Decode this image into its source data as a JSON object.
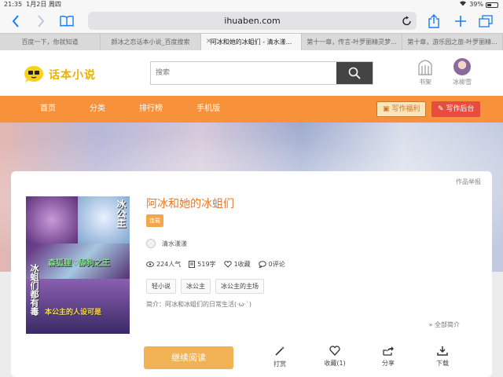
{
  "status_bar": {
    "time": "21:35",
    "date": "1月2日 周四",
    "battery_text": "39%",
    "battery_level": 0.39
  },
  "browser": {
    "url": "ihuaben.com",
    "tabs": [
      {
        "title": "百度一下，你就知道",
        "active": false
      },
      {
        "title": "颜冰之恋话本小说_百度搜索",
        "active": false
      },
      {
        "title": "阿冰和她的冰蛆们 - 清水漾...",
        "active": true
      },
      {
        "title": "第十一章，传言-叶罗丽精灵梦...",
        "active": false
      },
      {
        "title": "第十章，游乐园之旅-叶罗丽精...",
        "active": false
      }
    ]
  },
  "site": {
    "logo_text": "话本小说",
    "search_placeholder": "搜索",
    "bookshelf_label": "书架",
    "user_name": "冰柳雪"
  },
  "nav": {
    "items": [
      "首页",
      "分类",
      "排行榜",
      "手机版"
    ],
    "welfare_label": "写作福利",
    "backend_label": "写作后台"
  },
  "book": {
    "report_label": "作品举报",
    "title": "阿冰和她的冰蛆们",
    "status_badge": "连载",
    "author": "清水漾漾",
    "stats": {
      "popularity": "224人气",
      "words": "519字",
      "favorites": "1收藏",
      "comments": "0评论"
    },
    "tags": [
      "轻小说",
      "冰公主",
      "冰公主的主场"
    ],
    "summary": "简介：阿冰和冰蛆们的日常生活(·ω·`)",
    "expand_label": "全部简介",
    "cover": {
      "title_right": "冰公主",
      "title_left": "冰蛆们都有毒",
      "middle": "森狐狸♡舔狗之王",
      "bottom": "本公主的人设可是"
    }
  },
  "actions": {
    "continue_label": "继续阅读",
    "reward_label": "打赏",
    "favorite_label": "收藏(1)",
    "share_label": "分享",
    "download_label": "下载"
  }
}
